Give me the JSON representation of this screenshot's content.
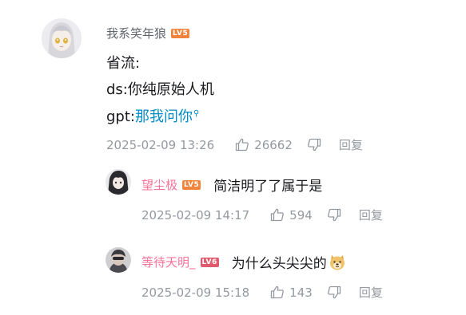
{
  "comment": {
    "username": "我系笑年狼",
    "level": "LV5",
    "lines": [
      "省流:",
      "ds:你纯原始人机"
    ],
    "line3_prefix": "gpt:",
    "line3_link": "那我问你",
    "time": "2025-02-09 13:26",
    "likes": "26662",
    "reply_label": "回复"
  },
  "replies": [
    {
      "username": "望尘极",
      "level": "LV5",
      "text": "简洁明了了属于是",
      "time": "2025-02-09 14:17",
      "likes": "594",
      "reply_label": "回复"
    },
    {
      "username": "等待天明_",
      "level": "LV6",
      "text": "为什么头尖尖的",
      "emoji": "doge-emoji",
      "time": "2025-02-09 15:18",
      "likes": "143",
      "reply_label": "回复"
    }
  ],
  "colors": {
    "username_main": "#61666d",
    "username_reply": "#fb7299",
    "meta": "#9499a0",
    "link": "#008ac5"
  }
}
